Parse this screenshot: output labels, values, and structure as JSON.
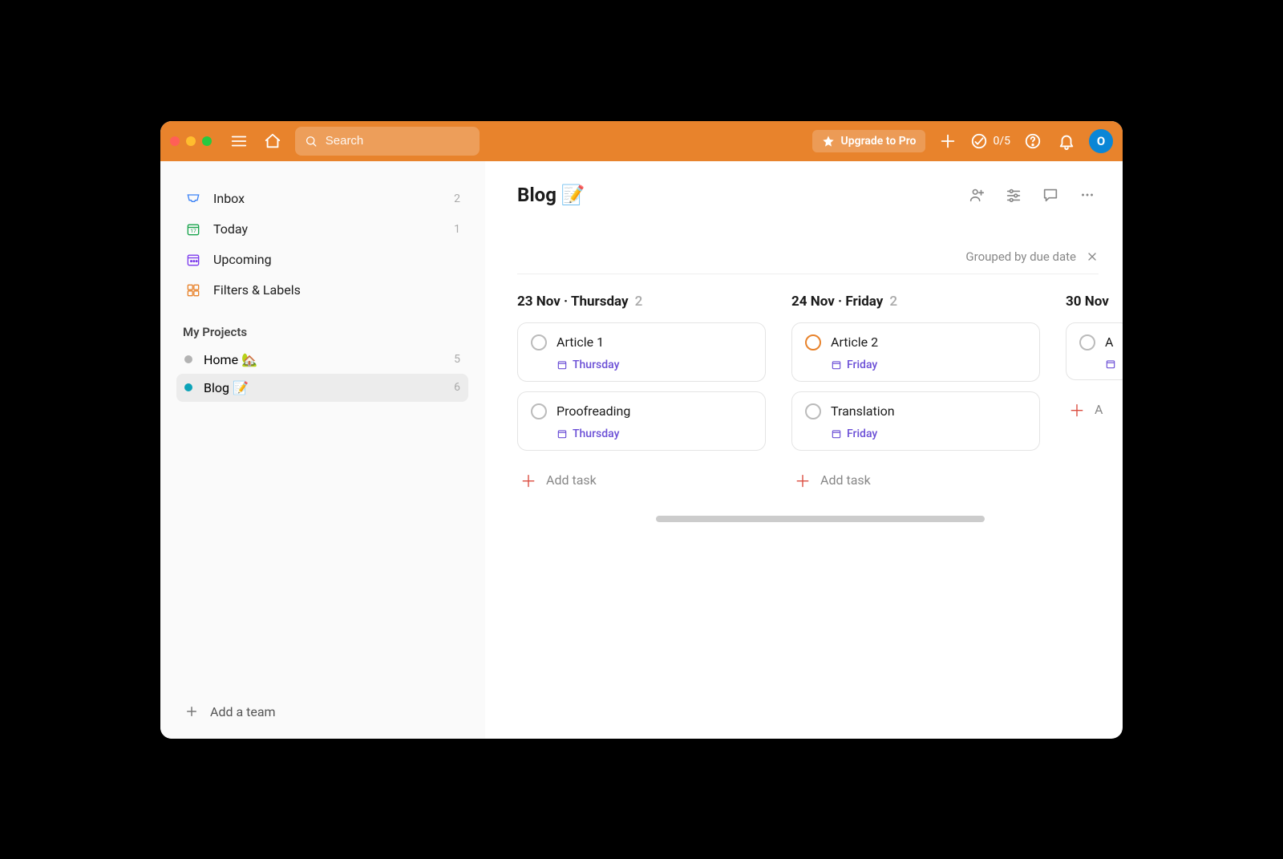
{
  "header": {
    "search_placeholder": "Search",
    "upgrade_label": "Upgrade to Pro",
    "progress_label": "0/5",
    "avatar_initial": "O"
  },
  "sidebar": {
    "nav": [
      {
        "label": "Inbox",
        "count": "2"
      },
      {
        "label": "Today",
        "count": "1"
      },
      {
        "label": "Upcoming",
        "count": ""
      },
      {
        "label": "Filters & Labels",
        "count": ""
      }
    ],
    "projects_title": "My Projects",
    "projects": [
      {
        "label": "Home 🏡",
        "count": "5",
        "color": "#b3b3b3"
      },
      {
        "label": "Blog 📝",
        "count": "6",
        "color": "#0ca3b8"
      }
    ],
    "add_team_label": "Add a team"
  },
  "main": {
    "title": "Blog 📝",
    "grouped_label": "Grouped by due date",
    "columns": [
      {
        "heading": "23 Nov · Thursday",
        "count": "2",
        "tasks": [
          {
            "title": "Article 1",
            "due": "Thursday",
            "priority": "normal"
          },
          {
            "title": "Proofreading",
            "due": "Thursday",
            "priority": "normal"
          }
        ],
        "add_label": "Add task"
      },
      {
        "heading": "24 Nov · Friday",
        "count": "2",
        "tasks": [
          {
            "title": "Article 2",
            "due": "Friday",
            "priority": "p1"
          },
          {
            "title": "Translation",
            "due": "Friday",
            "priority": "normal"
          }
        ],
        "add_label": "Add task"
      },
      {
        "heading": "30 Nov",
        "count": "",
        "tasks": [
          {
            "title": "A",
            "due": "",
            "priority": "normal"
          }
        ],
        "add_label": "A"
      }
    ]
  }
}
